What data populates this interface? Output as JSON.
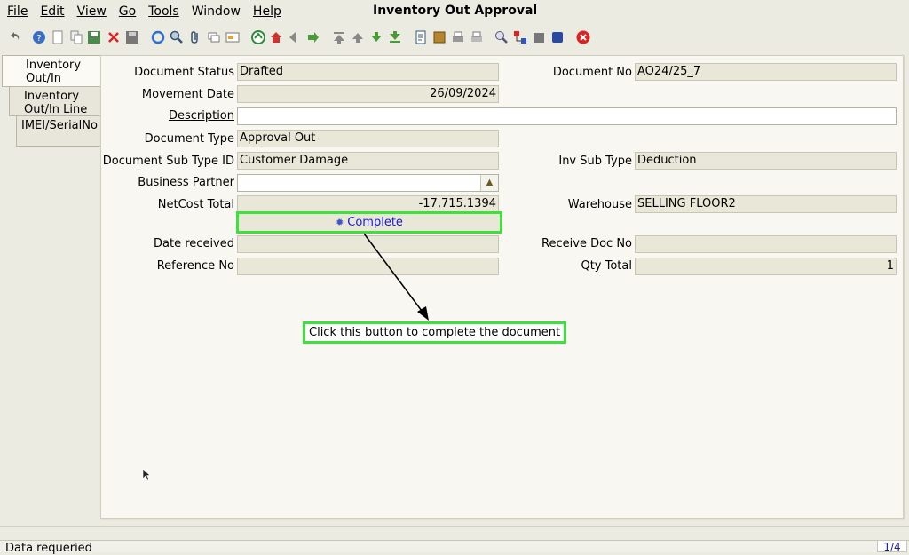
{
  "menubar": {
    "items": [
      "File",
      "Edit",
      "View",
      "Go",
      "Tools",
      "Window",
      "Help"
    ],
    "window_title": "Inventory Out Approval"
  },
  "tabs": [
    {
      "label": "Inventory\nOut/In"
    },
    {
      "label": "Inventory\nOut/In Line"
    },
    {
      "label": "IMEI/SerialNo"
    }
  ],
  "form": {
    "document_status": {
      "label": "Document Status",
      "value": "Drafted"
    },
    "document_no": {
      "label": "Document No",
      "value": "AO24/25_7"
    },
    "movement_date": {
      "label": "Movement Date",
      "value": "26/09/2024"
    },
    "description": {
      "label": "Description",
      "value": ""
    },
    "document_type": {
      "label": "Document Type",
      "value": "Approval Out"
    },
    "document_sub_type": {
      "label": "Document Sub Type ID",
      "value": "Customer Damage"
    },
    "inv_sub_type": {
      "label": "Inv Sub Type",
      "value": "Deduction"
    },
    "business_partner": {
      "label": "Business Partner",
      "value": ""
    },
    "netcost_total": {
      "label": "NetCost Total",
      "value": "-17,715.1394"
    },
    "warehouse": {
      "label": "Warehouse",
      "value": "SELLING FLOOR2"
    },
    "complete_button": {
      "label": "Complete"
    },
    "date_received": {
      "label": "Date received",
      "value": ""
    },
    "receive_doc_no": {
      "label": "Receive Doc No",
      "value": ""
    },
    "reference_no": {
      "label": "Reference No",
      "value": ""
    },
    "qty_total": {
      "label": "Qty Total",
      "value": "1"
    }
  },
  "annotation": {
    "text": "Click this button to complete the document"
  },
  "status": {
    "message": "Data requeried",
    "page": "1/4"
  },
  "colors": {
    "highlight": "#3ee03b",
    "accent": "#1a1acc"
  }
}
